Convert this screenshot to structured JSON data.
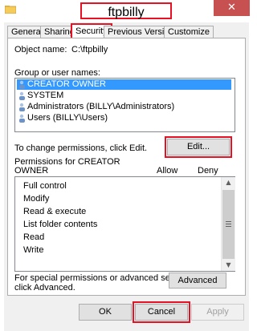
{
  "window": {
    "title": "ftpbilly Properties",
    "close_glyph": "✕"
  },
  "tabs": [
    {
      "label": "General"
    },
    {
      "label": "Sharing"
    },
    {
      "label": "Security"
    },
    {
      "label": "Previous Versions"
    },
    {
      "label": "Customize"
    }
  ],
  "security": {
    "object_name_label": "Object name:",
    "object_name_value": "C:\\ftpbilly",
    "group_label": "Group or user names:",
    "users": [
      {
        "name": "CREATOR OWNER",
        "selected": true
      },
      {
        "name": "SYSTEM",
        "selected": false
      },
      {
        "name": "Administrators (BILLY\\Administrators)",
        "selected": false
      },
      {
        "name": "Users (BILLY\\Users)",
        "selected": false
      }
    ],
    "change_text": "To change permissions, click Edit.",
    "edit_label": "Edit...",
    "perm_for_line1": "Permissions for CREATOR",
    "perm_for_line2": "OWNER",
    "allow_header": "Allow",
    "deny_header": "Deny",
    "permissions": [
      {
        "name": "Full control"
      },
      {
        "name": "Modify"
      },
      {
        "name": "Read & execute"
      },
      {
        "name": "List folder contents"
      },
      {
        "name": "Read"
      },
      {
        "name": "Write"
      }
    ],
    "special_line1": "For special permissions or advanced settings,",
    "special_line2": "click Advanced.",
    "advanced_label": "Advanced"
  },
  "footer": {
    "ok_label": "OK",
    "cancel_label": "Cancel",
    "apply_label": "Apply"
  },
  "colors": {
    "highlight": "#3399ff",
    "annotation_red": "#e81123"
  },
  "icons": [
    "folder-icon",
    "close-icon",
    "user-group-icon",
    "scroll-up-icon",
    "scroll-down-icon",
    "scroll-grip-icon"
  ]
}
